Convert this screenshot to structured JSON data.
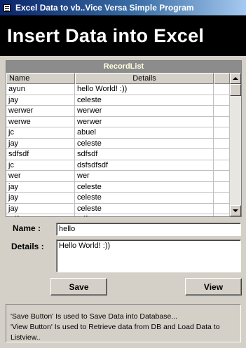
{
  "window": {
    "title": "Excel Data to vb..Vice Versa Simple Program"
  },
  "banner": {
    "heading": "Insert Data into Excel"
  },
  "record_list": {
    "caption": "RecordList",
    "columns": [
      "Name",
      "Details"
    ],
    "rows": [
      {
        "name": "ayun",
        "details": "hello World! :))"
      },
      {
        "name": "jay",
        "details": "celeste"
      },
      {
        "name": "werwer",
        "details": "werwer"
      },
      {
        "name": "werwe",
        "details": "werwer"
      },
      {
        "name": "jc",
        "details": "abuel"
      },
      {
        "name": "jay",
        "details": "celeste"
      },
      {
        "name": "sdfsdf",
        "details": "sdfsdf"
      },
      {
        "name": "jc",
        "details": "dsfsdfsdf"
      },
      {
        "name": "wer",
        "details": "wer"
      },
      {
        "name": "jay",
        "details": "celeste"
      },
      {
        "name": "jay",
        "details": "celeste"
      },
      {
        "name": "jay",
        "details": "celeste"
      },
      {
        "name": "sdfsc",
        "details": "sdfsc"
      }
    ]
  },
  "form": {
    "name_label": "Name :",
    "name_value": "hello",
    "details_label": "Details :",
    "details_value": "Hello World! :))"
  },
  "buttons": {
    "save": "Save",
    "view": "View"
  },
  "info": {
    "line1": "'Save Button' Is used to Save Data into Database...",
    "line2": "'View Button' Is used to Retrieve data from DB and Load Data to Listview.."
  },
  "icons": {
    "app": "app-icon",
    "scroll_up": "scroll-up-arrow-icon",
    "scroll_down": "scroll-down-arrow-icon"
  }
}
